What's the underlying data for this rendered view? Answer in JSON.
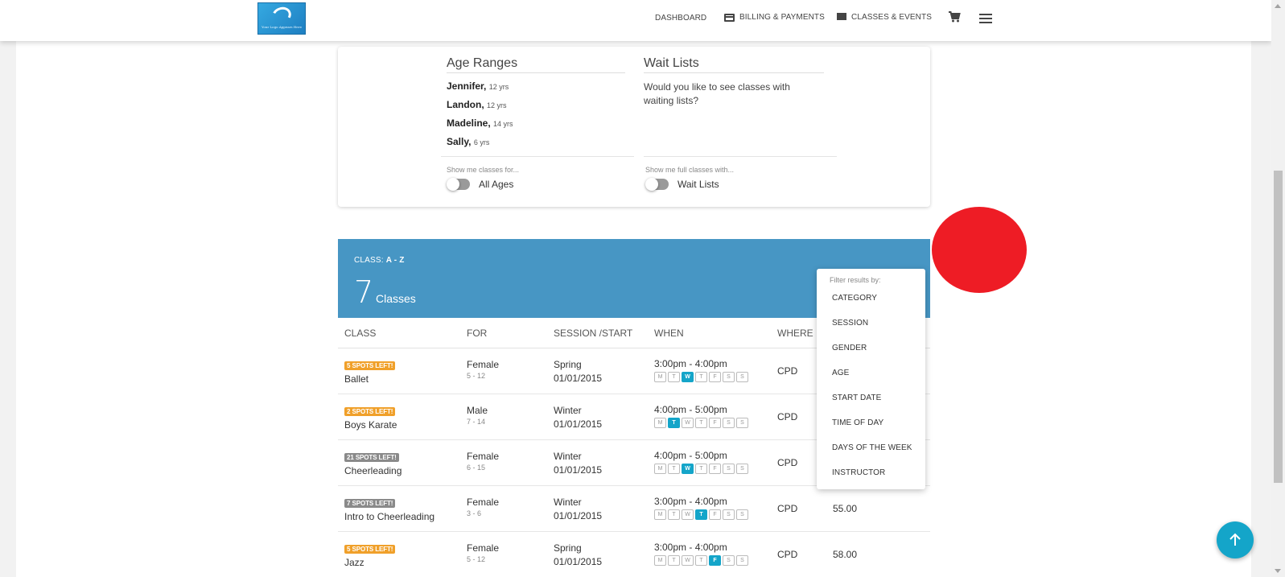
{
  "header": {
    "logo_text": "Your Logo Appears Here",
    "nav": [
      {
        "label": "DASHBOARD",
        "icon": "dashboard-icon"
      },
      {
        "label": "BILLING & PAYMENTS",
        "icon": "credit-card-icon"
      },
      {
        "label": "CLASSES & EVENTS",
        "icon": "list-icon"
      }
    ],
    "cart_icon": "cart-icon",
    "menu_icon": "hamburger-menu-icon"
  },
  "filters": {
    "age_ranges": {
      "title": "Age Ranges",
      "kids": [
        {
          "name": "Jennifer,",
          "age": "12 yrs"
        },
        {
          "name": "Landon,",
          "age": "12 yrs"
        },
        {
          "name": "Madeline,",
          "age": "14 yrs"
        },
        {
          "name": "Sally,",
          "age": "6 yrs"
        }
      ],
      "show_label": "Show me classes for...",
      "toggle_label": "All Ages"
    },
    "wait_lists": {
      "title": "Wait Lists",
      "question": "Would you like to see classes with waiting lists?",
      "show_label": "Show me full classes with...",
      "toggle_label": "Wait Lists"
    }
  },
  "classes": {
    "sort_prefix": "CLASS:",
    "sort_value": "A - Z",
    "count": "7",
    "count_label": "Classes",
    "columns": [
      "CLASS",
      "FOR",
      "SESSION /START",
      "WHEN",
      "WHERE"
    ],
    "day_letters": [
      "M",
      "T",
      "W",
      "T",
      "F",
      "S",
      "S"
    ],
    "rows": [
      {
        "badge": "5 SPOTS LEFT!",
        "badge_color": "#f0a02a",
        "name": "Ballet",
        "gender": "Female",
        "ages": "5 - 12",
        "session": "Spring",
        "start": "01/01/2015",
        "time": "3:00pm - 4:00pm",
        "active_day": 2,
        "where": "CPD",
        "price": ""
      },
      {
        "badge": "2 SPOTS LEFT!",
        "badge_color": "#f0a02a",
        "name": "Boys Karate",
        "gender": "Male",
        "ages": "7 - 14",
        "session": "Winter",
        "start": "01/01/2015",
        "time": "4:00pm - 5:00pm",
        "active_day": 1,
        "where": "CPD",
        "price": ""
      },
      {
        "badge": "21 SPOTS LEFT!",
        "badge_color": "#8a8a8a",
        "name": "Cheerleading",
        "gender": "Female",
        "ages": "6 - 15",
        "session": "Winter",
        "start": "01/01/2015",
        "time": "4:00pm - 5:00pm",
        "active_day": 2,
        "where": "CPD",
        "price": ""
      },
      {
        "badge": "7 SPOTS LEFT!",
        "badge_color": "#8a8a8a",
        "name": "Intro to Cheerleading",
        "gender": "Female",
        "ages": "3 - 6",
        "session": "Winter",
        "start": "01/01/2015",
        "time": "3:00pm - 4:00pm",
        "active_day": 3,
        "where": "CPD",
        "price": "55.00"
      },
      {
        "badge": "5 SPOTS LEFT!",
        "badge_color": "#f0a02a",
        "name": "Jazz",
        "gender": "Female",
        "ages": "5 - 12",
        "session": "Spring",
        "start": "01/01/2015",
        "time": "3:00pm - 4:00pm",
        "active_day": 4,
        "where": "CPD",
        "price": "58.00"
      }
    ]
  },
  "filter_menu": {
    "title": "Filter results by:",
    "items": [
      "CATEGORY",
      "SESSION",
      "GENDER",
      "AGE",
      "START DATE",
      "TIME OF DAY",
      "DAYS OF THE WEEK",
      "INSTRUCTOR"
    ]
  },
  "colors": {
    "accent": "#4796c4",
    "teal": "#14a5c9",
    "marker": "#ee1c25"
  },
  "fab_icon": "arrow-up-icon"
}
